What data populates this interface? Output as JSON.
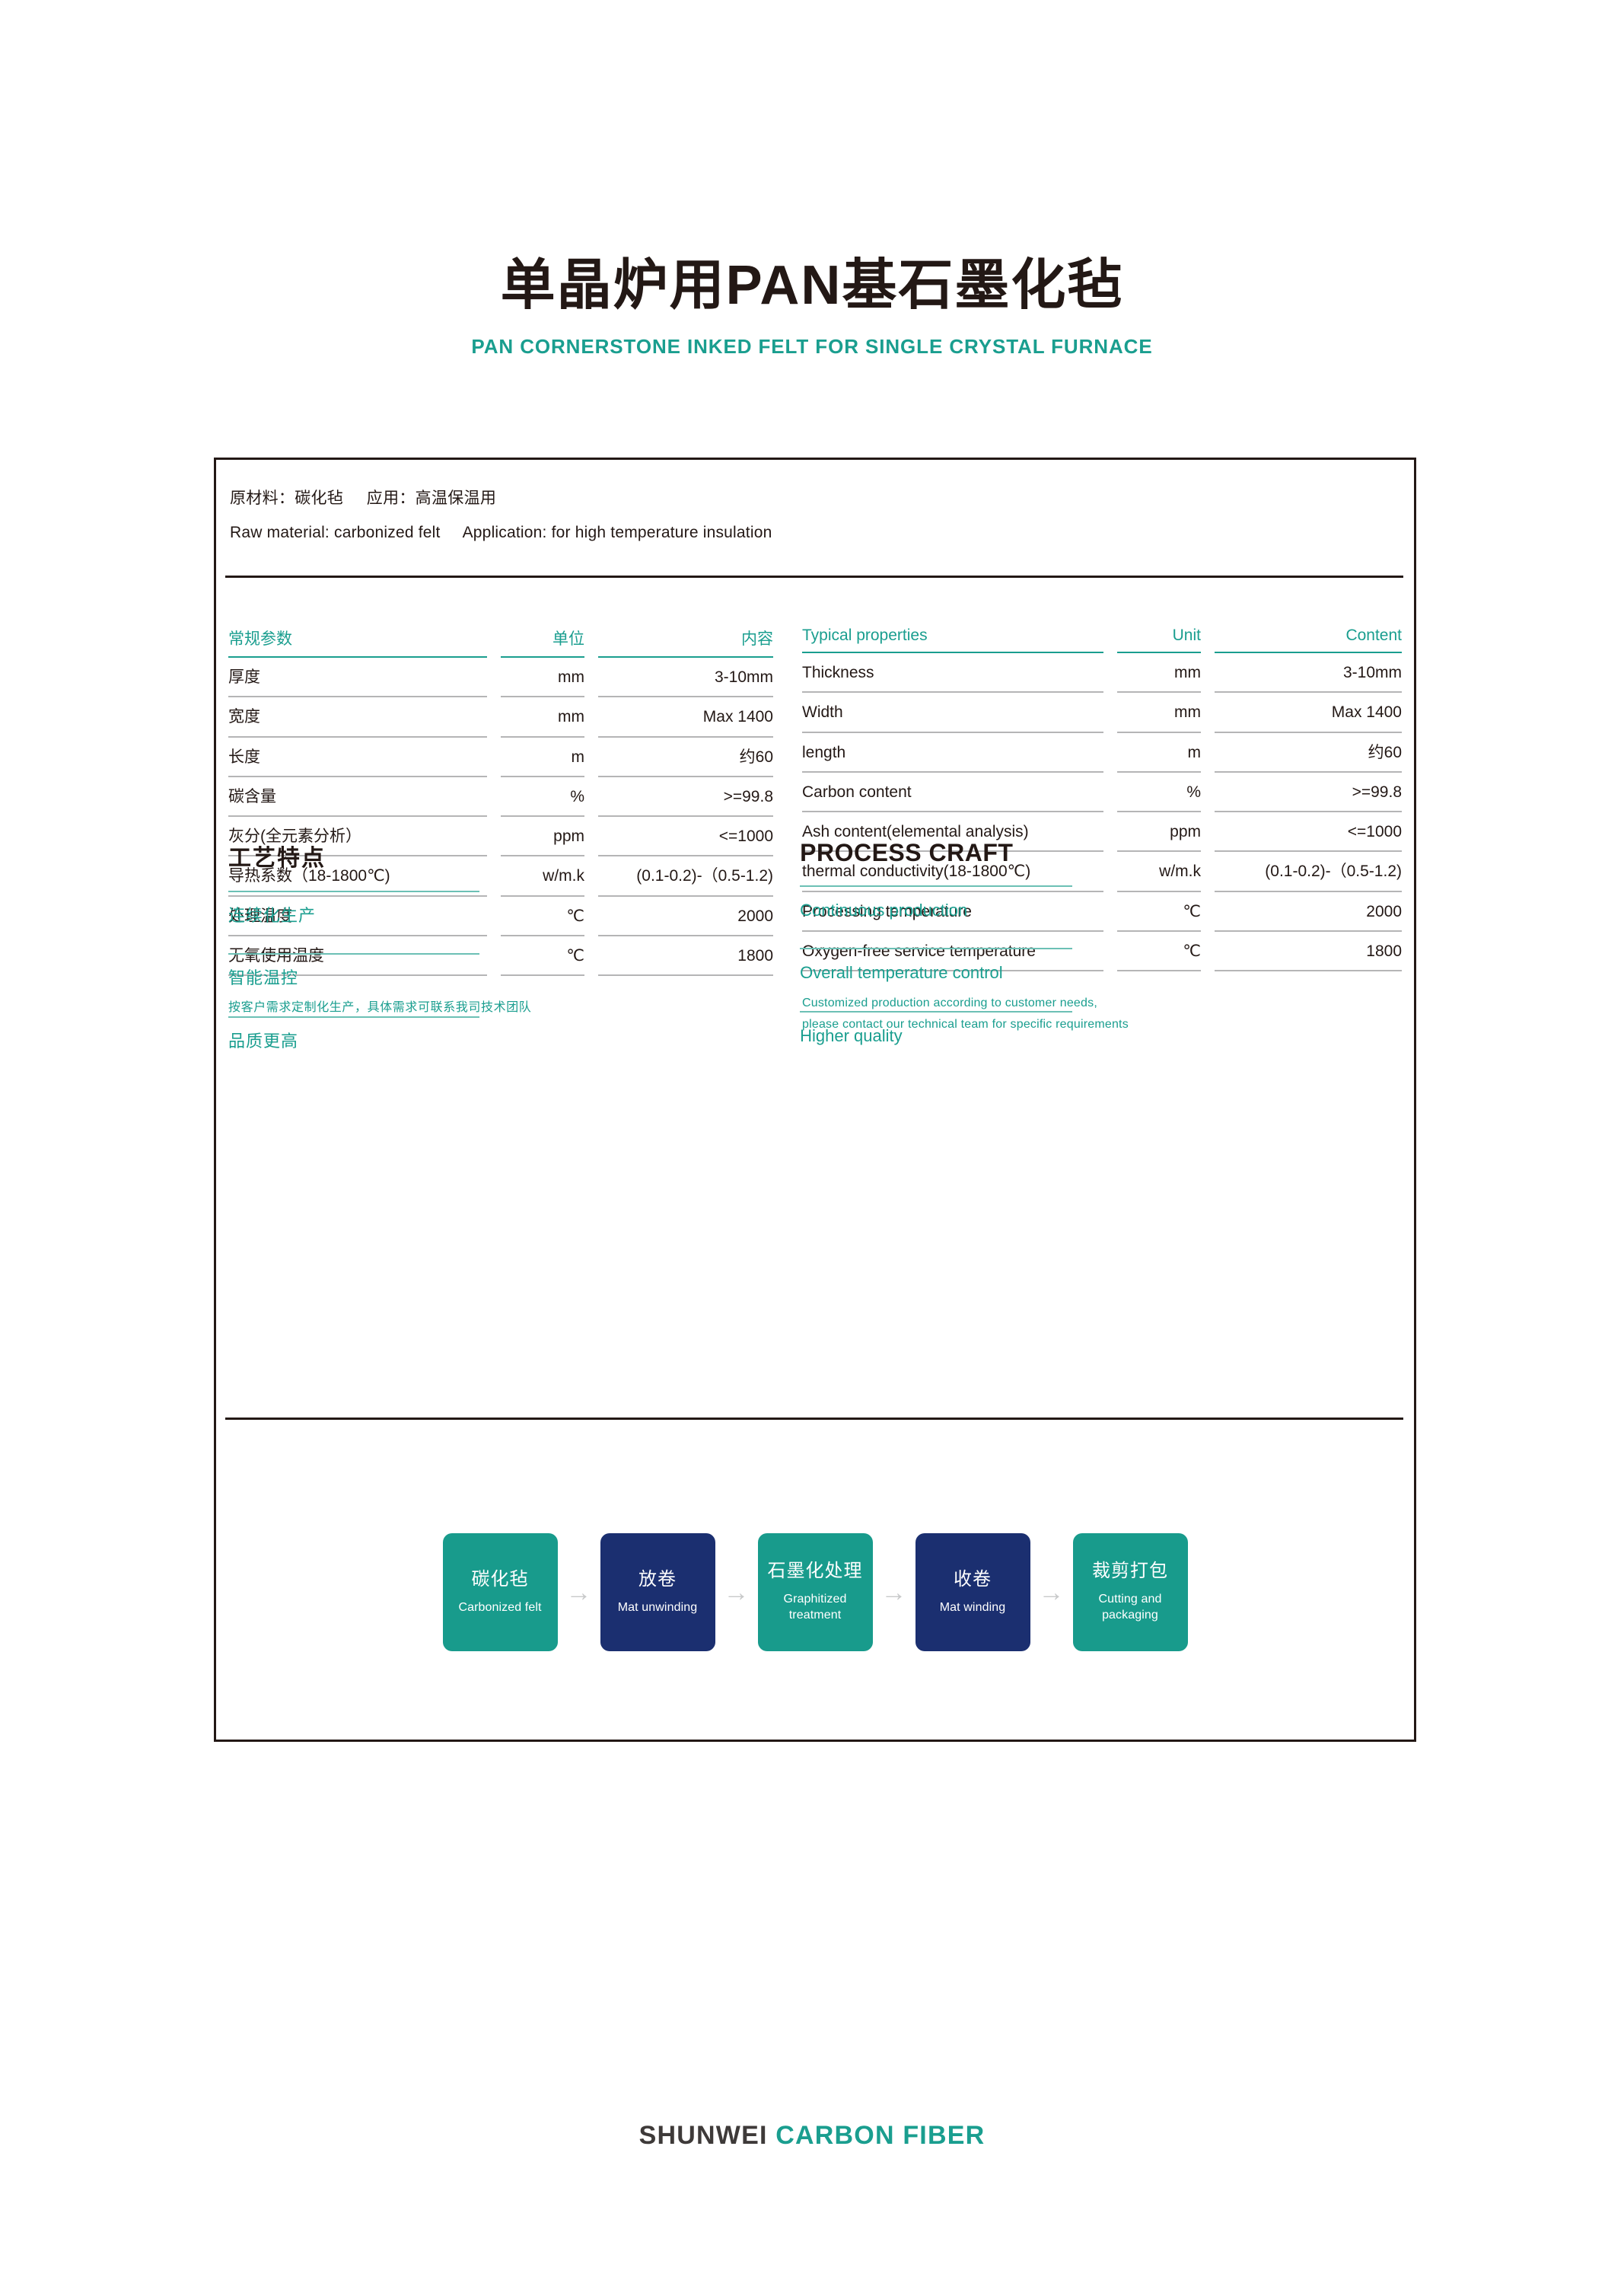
{
  "header": {
    "title_cn": "单晶炉用PAN基石墨化毡",
    "title_en": "PAN CORNERSTONE INKED FELT FOR SINGLE CRYSTAL FURNACE"
  },
  "material_info": {
    "cn": "原材料：碳化毡     应用：高温保温用",
    "en": "Raw material: carbonized felt     Application: for high temperature insulation"
  },
  "spec_table_cn": {
    "headers": [
      "常规参数",
      "单位",
      "内容"
    ],
    "rows": [
      {
        "name": "厚度",
        "unit": "mm",
        "content": "3-10mm"
      },
      {
        "name": "宽度",
        "unit": "mm",
        "content": "Max 1400"
      },
      {
        "name": "长度",
        "unit": "m",
        "content": "约60"
      },
      {
        "name": "碳含量",
        "unit": "%",
        "content": ">=99.8"
      },
      {
        "name": "灰分(全元素分析）",
        "unit": "ppm",
        "content": "<=1000"
      },
      {
        "name": "导热系数（18-1800℃)",
        "unit": "w/m.k",
        "content": "(0.1-0.2)-（0.5-1.2)"
      },
      {
        "name": "处理温度",
        "unit": "℃",
        "content": "2000"
      },
      {
        "name": "无氧使用温度",
        "unit": "℃",
        "content": "1800"
      }
    ],
    "note": "按客户需求定制化生产，具体需求可联系我司技术团队"
  },
  "spec_table_en": {
    "headers": [
      "Typical properties",
      "Unit",
      "Content"
    ],
    "rows": [
      {
        "name": "Thickness",
        "unit": "mm",
        "content": "3-10mm"
      },
      {
        "name": "Width",
        "unit": "mm",
        "content": "Max 1400"
      },
      {
        "name": "length",
        "unit": "m",
        "content": "约60"
      },
      {
        "name": "Carbon content",
        "unit": "%",
        "content": ">=99.8"
      },
      {
        "name": "Ash content(elemental analysis)",
        "unit": "ppm",
        "content": "<=1000"
      },
      {
        "name": "thermal conductivity(18-1800℃)",
        "unit": "w/m.k",
        "content": "(0.1-0.2)-（0.5-1.2)"
      },
      {
        "name": "Processing temperature",
        "unit": "℃",
        "content": "2000"
      },
      {
        "name": "Oxygen-free service temperature",
        "unit": "℃",
        "content": "1800"
      }
    ],
    "note_line1": "Customized production according to customer needs,",
    "note_line2": "please contact our technical team for specific requirements"
  },
  "process_craft_cn": {
    "title": "工艺特点",
    "items": [
      "连续化生产",
      "智能温控",
      "品质更高"
    ]
  },
  "process_craft_en": {
    "title": "PROCESS CRAFT",
    "items": [
      "Continuous production",
      "Overall temperature control",
      "Higher quality"
    ]
  },
  "flow": {
    "arrow": "→",
    "steps": [
      {
        "cn": "碳化毡",
        "en": "Carbonized felt",
        "color": "teal"
      },
      {
        "cn": "放卷",
        "en": "Mat unwinding",
        "color": "navy"
      },
      {
        "cn": "石墨化处理",
        "en": "Graphitized treatment",
        "color": "teal"
      },
      {
        "cn": "收卷",
        "en": "Mat winding",
        "color": "navy"
      },
      {
        "cn": "裁剪打包",
        "en": "Cutting and packaging",
        "color": "teal"
      }
    ]
  },
  "footer": {
    "brand_dark": "SHUNWEI",
    "brand_accent": "CARBON FIBER"
  },
  "colors": {
    "teal": "#1a9e8f",
    "navy": "#1b2f70",
    "ink": "#231815",
    "rule_grey": "#b5b5b6",
    "arrow_grey": "#c8c9ca"
  }
}
